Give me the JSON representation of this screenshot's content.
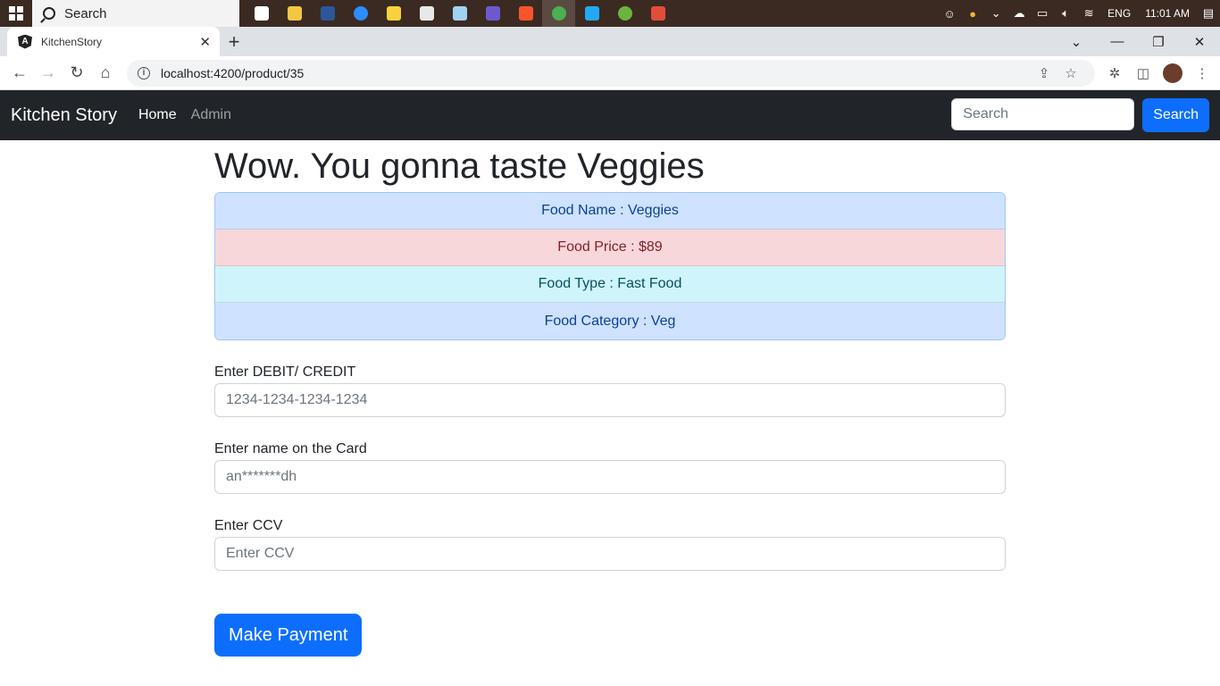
{
  "taskbar": {
    "search_label": "Search",
    "language": "ENG",
    "time": "11:01 AM",
    "apps": [
      {
        "name": "task-view-icon",
        "color": "#ffffff"
      },
      {
        "name": "file-explorer-icon",
        "color": "#f2c744"
      },
      {
        "name": "word-icon",
        "color": "#2b579a"
      },
      {
        "name": "zoom-icon",
        "color": "#2d8cff"
      },
      {
        "name": "sticky-notes-icon",
        "color": "#f7d23e"
      },
      {
        "name": "paint-icon",
        "color": "#e8e8e8"
      },
      {
        "name": "notepad-icon",
        "color": "#9fd3f0"
      },
      {
        "name": "media-player-icon",
        "color": "#6a5acd"
      },
      {
        "name": "brave-icon",
        "color": "#fb542b"
      },
      {
        "name": "chrome-icon",
        "color": "#4caf50"
      },
      {
        "name": "vscode-icon",
        "color": "#23a9f2"
      },
      {
        "name": "spring-tool-icon",
        "color": "#6db33f"
      },
      {
        "name": "git-gui-icon",
        "color": "#e04e39"
      }
    ]
  },
  "browser": {
    "tab_title": "KitchenStory",
    "tab_favicon": "A",
    "url": "localhost:4200/product/35"
  },
  "navbar": {
    "brand": "Kitchen Story",
    "links": [
      "Home",
      "Admin"
    ],
    "search_placeholder": "Search",
    "search_button": "Search"
  },
  "product": {
    "heading": "Wow. You gonna taste Veggies",
    "details": [
      {
        "text": "Food Name : Veggies",
        "variant": "primary"
      },
      {
        "text": "Food Price : $89",
        "variant": "danger"
      },
      {
        "text": "Food Type : Fast Food",
        "variant": "info"
      },
      {
        "text": "Food Category : Veg",
        "variant": "primary"
      }
    ]
  },
  "payment": {
    "card_label": "Enter DEBIT/ CREDIT",
    "card_placeholder": "1234-1234-1234-1234",
    "name_label": "Enter name on the Card",
    "name_placeholder": "an*******dh",
    "ccv_label": "Enter CCV",
    "ccv_placeholder": "Enter CCV",
    "submit_label": "Make Payment"
  }
}
